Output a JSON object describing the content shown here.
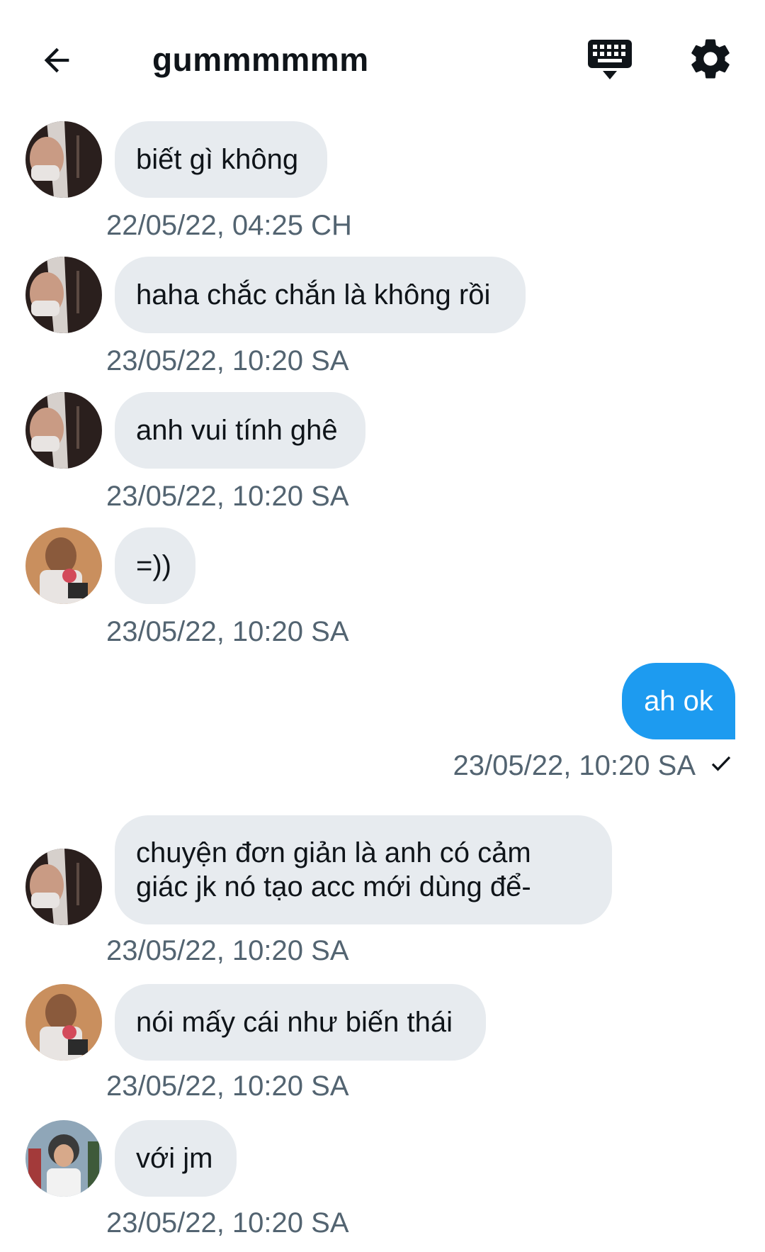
{
  "header": {
    "title": "gummmmmm"
  },
  "icons": {
    "back": "arrow-left-icon",
    "keyboard": "keyboard-icon",
    "settings": "gear-icon"
  },
  "colors": {
    "incoming_bubble": "#e7ebef",
    "outgoing_bubble": "#1d9bf0",
    "timestamp": "#536471"
  },
  "messages": [
    {
      "text": "biết gì không",
      "time": "22/05/22, 04:25 CH"
    },
    {
      "text": "haha chắc chắn là không rồi",
      "time": "23/05/22, 10:20 SA"
    },
    {
      "text": "anh vui tính ghê",
      "time": "23/05/22, 10:20 SA"
    },
    {
      "text": "=))",
      "time": "23/05/22, 10:20 SA"
    },
    {
      "text": "ah ok",
      "time": "23/05/22, 10:20 SA",
      "outgoing": true
    },
    {
      "text": "chuyện đơn giản là anh có cảm giác jk nó tạo acc mới dùng để-",
      "time": "23/05/22, 10:20 SA"
    },
    {
      "text": "nói mấy cái như biến thái",
      "time": "23/05/22, 10:20 SA"
    },
    {
      "text": "với jm",
      "time": "23/05/22, 10:20 SA"
    }
  ]
}
